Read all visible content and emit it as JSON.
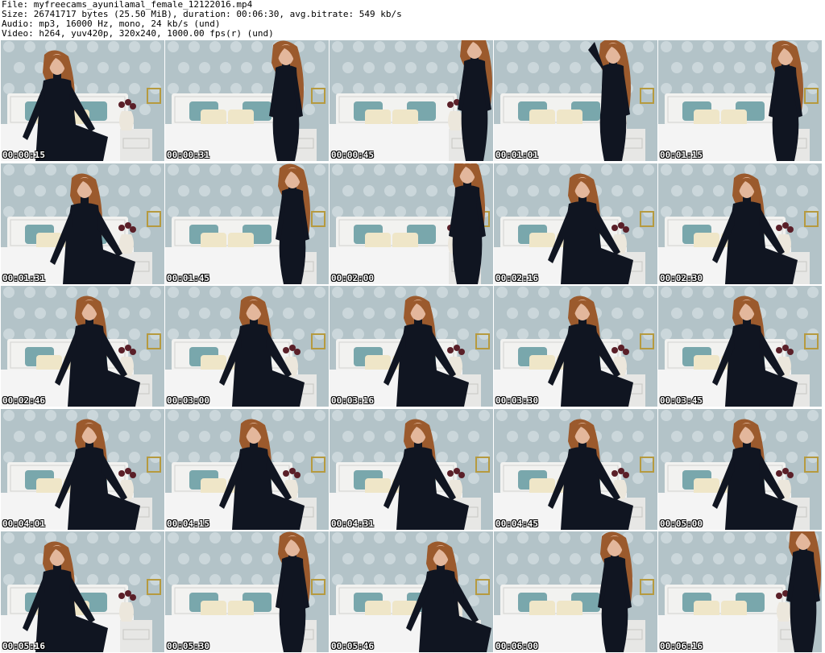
{
  "info": {
    "file_line": "File: myfreecams_ayunilamal_female_12122016.mp4",
    "size_line": "Size: 26741717 bytes (25.50 MiB), duration: 00:06:30, avg.bitrate: 549 kb/s",
    "audio_line": "Audio: mp3, 16000 Hz, mono, 24 kb/s (und)",
    "video_line": "Video: h264, yuv420p, 320x240, 1000.00 fps(r) (und)"
  },
  "thumbnails": [
    {
      "timestamp": "00:00:15",
      "pose": "sit-left"
    },
    {
      "timestamp": "00:00:31",
      "pose": "stand-center"
    },
    {
      "timestamp": "00:00:45",
      "pose": "stand-right-edge"
    },
    {
      "timestamp": "00:01:01",
      "pose": "stand-arm-up"
    },
    {
      "timestamp": "00:01:15",
      "pose": "stand-right"
    },
    {
      "timestamp": "00:01:31",
      "pose": "lean-left"
    },
    {
      "timestamp": "00:01:45",
      "pose": "stand-right"
    },
    {
      "timestamp": "00:02:00",
      "pose": "lean-right"
    },
    {
      "timestamp": "00:02:16",
      "pose": "sit-center"
    },
    {
      "timestamp": "00:02:30",
      "pose": "sit-center"
    },
    {
      "timestamp": "00:02:46",
      "pose": "sit-center"
    },
    {
      "timestamp": "00:03:00",
      "pose": "sit-center"
    },
    {
      "timestamp": "00:03:16",
      "pose": "sit-center"
    },
    {
      "timestamp": "00:03:30",
      "pose": "sit-center"
    },
    {
      "timestamp": "00:03:45",
      "pose": "sit-center"
    },
    {
      "timestamp": "00:04:01",
      "pose": "sit-center"
    },
    {
      "timestamp": "00:04:15",
      "pose": "sit-center"
    },
    {
      "timestamp": "00:04:31",
      "pose": "sit-center"
    },
    {
      "timestamp": "00:04:45",
      "pose": "sit-center"
    },
    {
      "timestamp": "00:05:00",
      "pose": "sit-center"
    },
    {
      "timestamp": "00:05:16",
      "pose": "sit-left"
    },
    {
      "timestamp": "00:05:30",
      "pose": "stand-right"
    },
    {
      "timestamp": "00:05:46",
      "pose": "lean-center"
    },
    {
      "timestamp": "00:06:00",
      "pose": "stand-center"
    },
    {
      "timestamp": "00:06:16",
      "pose": "stand-right-edge"
    }
  ],
  "colors": {
    "wallpaper": "#b3c3c8",
    "wallpaper_pattern": "#d6dfe2",
    "bed": "#f4f4f4",
    "pillow_teal": "#79a7ac",
    "pillow_cream": "#efe6c8",
    "nightstand": "#e7e7e5",
    "outfit": "#101521",
    "hair": "#9b5a2d",
    "skin": "#e3b79c",
    "roses": "#5a1f28",
    "frame": "#b69a3f"
  }
}
